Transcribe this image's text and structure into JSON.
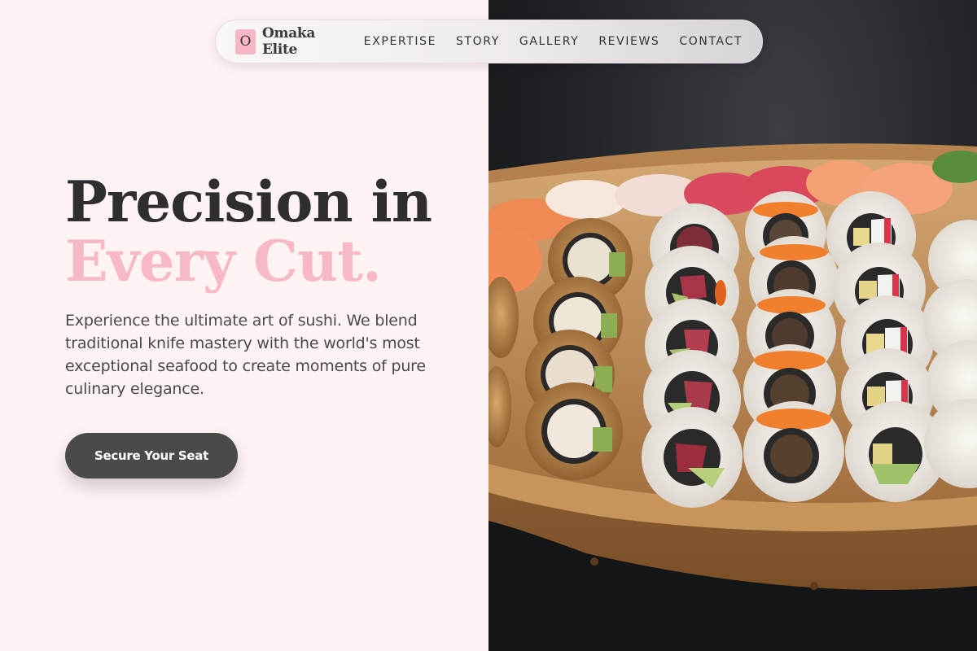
{
  "brand": {
    "logo_letter": "O",
    "name": "Omaka Elite",
    "accent_color": "#f7b9c6"
  },
  "nav": {
    "links": [
      "EXPERTISE",
      "STORY",
      "GALLERY",
      "REVIEWS",
      "CONTACT"
    ]
  },
  "hero": {
    "title_line1": "Precision in",
    "title_line2": "Every Cut.",
    "description": "Experience the ultimate art of sushi. We blend traditional knife mastery with the world's most exceptional seafood to create moments of pure culinary elegance.",
    "cta_label": "Secure Your Seat"
  },
  "image": {
    "subject": "sushi-boat-platter"
  }
}
